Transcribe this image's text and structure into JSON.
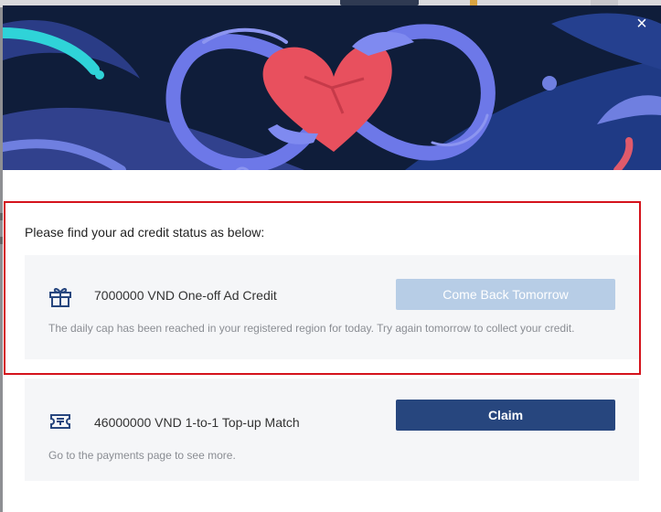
{
  "modal": {
    "close_label": "×",
    "intro_text": "Please find your ad credit status as below:"
  },
  "offers": [
    {
      "icon": "gift-icon",
      "title": "7000000 VND One-off Ad Credit",
      "button_label": "Come Back Tomorrow",
      "button_state": "disabled",
      "description": "The daily cap has been reached in your registered region for today. Try again tomorrow to collect your credit."
    },
    {
      "icon": "ticket-icon",
      "title": "46000000 VND 1-to-1 Top-up Match",
      "button_label": "Claim",
      "button_state": "enabled",
      "description": "Go to the payments page to see more."
    }
  ],
  "colors": {
    "hero_background": "#0f1d3a",
    "primary_button": "#27467e",
    "disabled_button": "#b7cde6",
    "highlight_border": "#d4131c",
    "card_background": "#f5f6f8"
  }
}
